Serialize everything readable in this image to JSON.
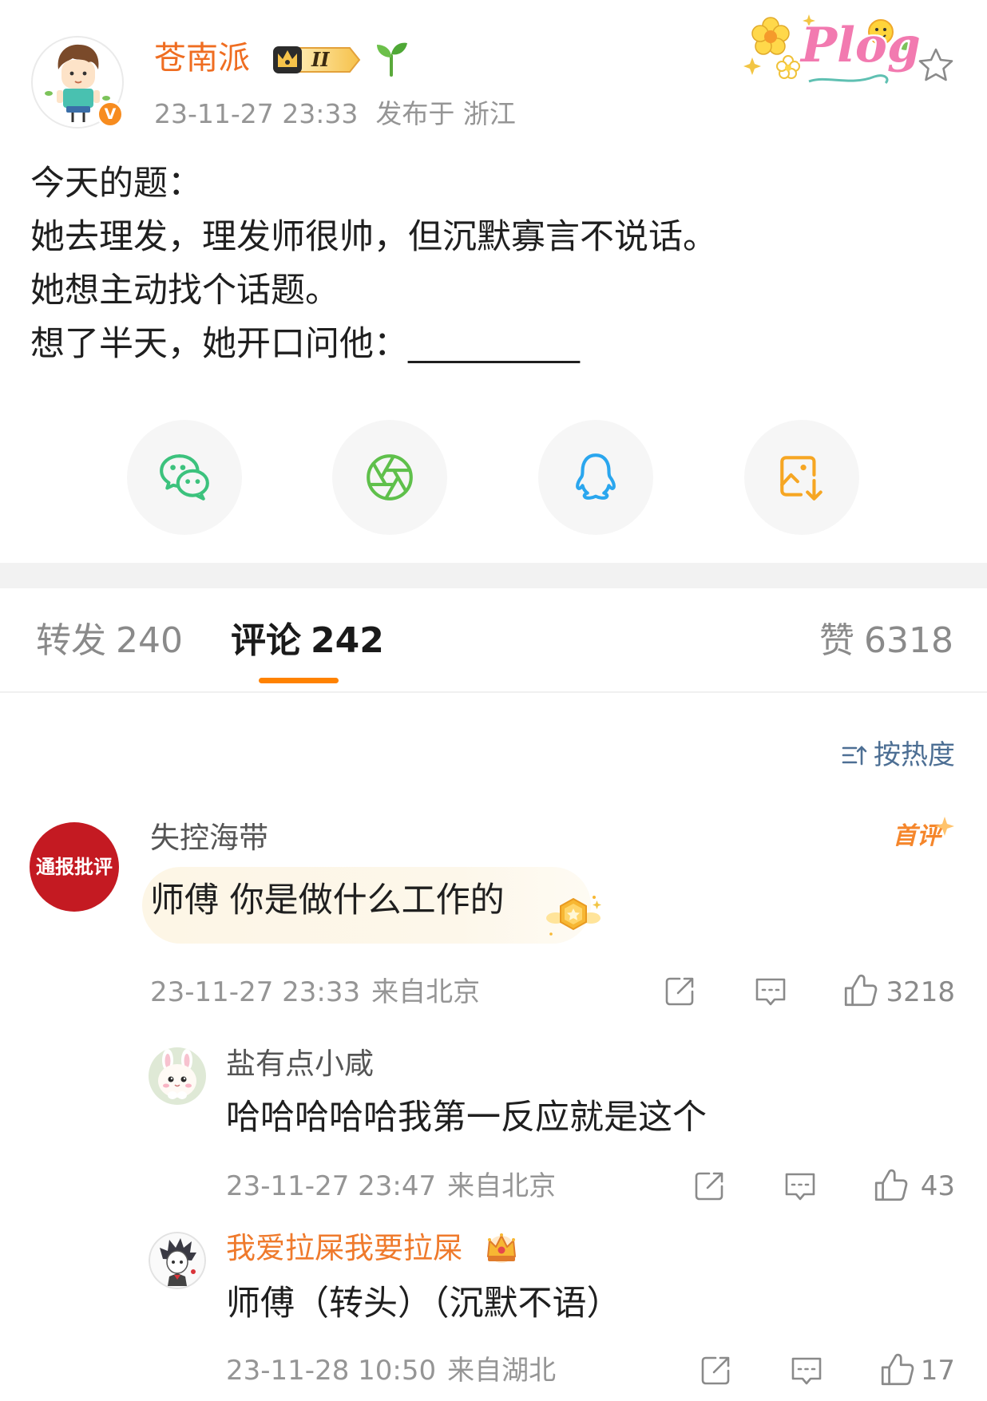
{
  "colors": {
    "accent": "#ff8200",
    "author_name": "#ef6d21",
    "vip_name": "#ef7a2c",
    "text": "#1f1f1f",
    "name": "#555555",
    "muted": "#959595",
    "link": "#4d6f94",
    "share_bg": "#f6f6f6",
    "band": "#f2f2f2"
  },
  "post": {
    "author": {
      "name": "苍南派",
      "verified_mark": "V",
      "level_badge": "II",
      "avatar_icon": "cartoon-boy-avatar"
    },
    "time": "23-11-27 23:33",
    "location": "发布于 浙江",
    "sticker": "Plog",
    "favorite_icon": "star-icon",
    "lines": [
      "今天的题：",
      "她去理发，理发师很帅，但沉默寡言不说话。",
      "她想主动找个话题。",
      "想了半天，她开口问他：__________"
    ]
  },
  "share_targets": [
    "wechat-icon",
    "moments-icon",
    "qq-icon",
    "save-image-icon"
  ],
  "tabs": {
    "repost": {
      "label": "转发",
      "count": "240"
    },
    "comment": {
      "label": "评论",
      "count": "242",
      "active": true
    },
    "like": {
      "label": "赞",
      "count": "6318"
    }
  },
  "sort": {
    "label": "按热度",
    "icon": "sort-icon"
  },
  "action_icons": [
    "forward-icon",
    "comment-icon",
    "like-icon"
  ],
  "comments": [
    {
      "user": "失控海带",
      "avatar_text": "通报批评",
      "badge": "首评",
      "text": "师傅 你是做什么工作的",
      "time": "23-11-27 23:33",
      "source": "来自北京",
      "likes": "3218",
      "replies": [
        {
          "user": "盐有点小咸",
          "text": "哈哈哈哈哈我第一反应就是这个",
          "time": "23-11-27 23:47",
          "source": "来自北京",
          "likes": "43"
        },
        {
          "user": "我爱拉屎我要拉屎",
          "badge_icon": "crown-icon",
          "text": "师傅（转头）（沉默不语）",
          "time": "23-11-28 10:50",
          "source": "来自湖北",
          "likes": "17"
        }
      ]
    }
  ]
}
